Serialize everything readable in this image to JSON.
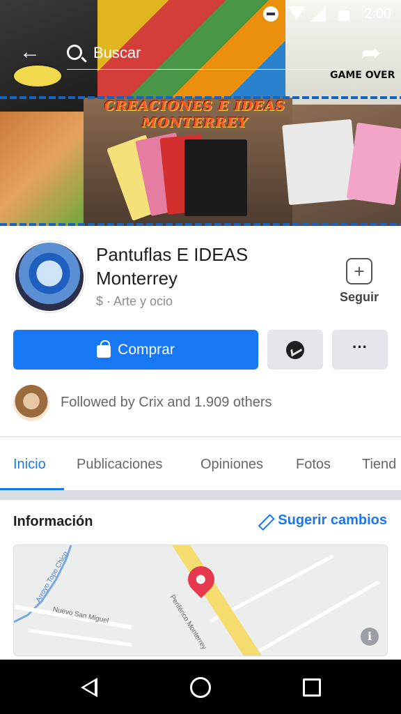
{
  "status_bar": {
    "time": "2:00"
  },
  "header": {
    "search_placeholder": "Buscar"
  },
  "cover": {
    "banner_line1": "CREACIONES E IDEAS",
    "banner_line2": "MONTERREY",
    "game_over_text": "GAME OVER"
  },
  "page": {
    "name_line1": "Pantuflas E IDEAS",
    "name_line2": "Monterrey",
    "category": "$ · Arte y ocio",
    "follow_label": "Seguir"
  },
  "actions": {
    "buy_label": "Comprar",
    "more_label": "···"
  },
  "followers": {
    "text": "Followed by Crix and 1.909 others"
  },
  "tabs": [
    {
      "label": "Inicio",
      "active": true
    },
    {
      "label": "Publicaciones",
      "active": false
    },
    {
      "label": "Opiniones",
      "active": false
    },
    {
      "label": "Fotos",
      "active": false
    },
    {
      "label": "Tiend",
      "active": false
    }
  ],
  "info": {
    "title": "Información",
    "suggest_label": "Sugerir cambios"
  },
  "map": {
    "labels": {
      "river": "Arroyo Topo Chico",
      "street": "Nuevo San Miguel",
      "road": "Periférico Monterrey"
    }
  },
  "colors": {
    "accent": "#1877f2",
    "pin": "#e53950",
    "button_grey": "#e4e6eb"
  }
}
